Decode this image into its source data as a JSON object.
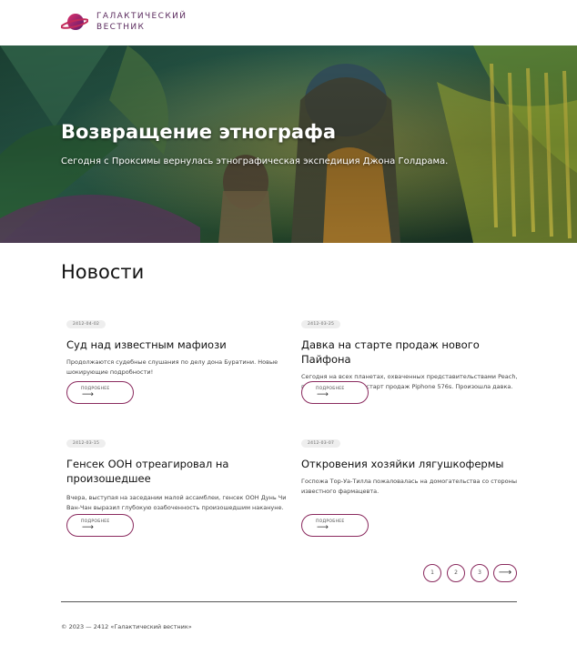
{
  "header": {
    "logo_line1": "ГАЛАКТИЧЕСКИЙ",
    "logo_line2": "ВЕСТНИК"
  },
  "hero": {
    "title": "Возвращение этнографа",
    "subtitle": "Сегодня с Проксимы вернулась этнографическая экспедиция Джона Голдрама."
  },
  "news": {
    "section_title": "Новости",
    "more_label": "ПОДРОБНЕЕ",
    "more_arrow": "⟶",
    "items": [
      {
        "date": "2412-04-02",
        "title": "Суд над известным мафиози",
        "text_lines": [
          "Продолжаются судебные слушания по делу дона Буратини. Новые",
          "шокирующие подробности!"
        ]
      },
      {
        "date": "2412-03-25",
        "title": "Давка на старте продаж нового Пайфона",
        "text_lines": [
          "Сегодня на всех планетах, охваченных представительствами Peach,",
          "прошел ожидаемый старт продаж Piphone 576s. Произошла давка."
        ]
      },
      {
        "date": "2412-03-15",
        "title_lines": [
          "Генсек ООН отреагировал на",
          "произошедшее"
        ],
        "text_lines": [
          "Вчера, выступая на заседании малой ассамблеи, генсек ООН Дунь Чи",
          "Ван-Чан выразил глубокую озабоченность произошедшим накануне."
        ]
      },
      {
        "date": "2412-03-07",
        "title": "Откровения хозяйки лягушкофермы",
        "text_lines": [
          "Госпожа Тор-Уа-Тилла пожаловалась на домогательства со стороны",
          "известного фармацевта."
        ]
      }
    ]
  },
  "pagination": {
    "pages": [
      "1",
      "2",
      "3"
    ],
    "next": "⟶"
  },
  "footer": {
    "copyright": "© 2023 — 2412 «Галактический вестник»"
  },
  "colors": {
    "accent": "#8a2a5e",
    "logo_text": "#5b2b5e"
  },
  "icons": {
    "logo": "planet-ring-icon",
    "more": "arrow-right-icon",
    "next": "arrow-right-icon"
  }
}
